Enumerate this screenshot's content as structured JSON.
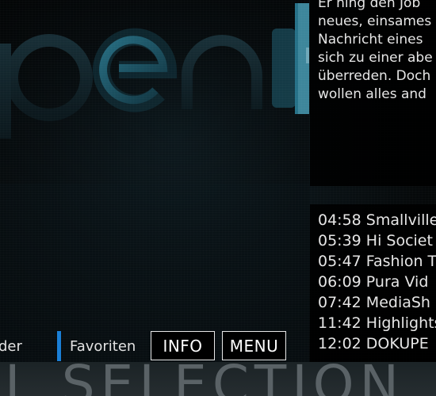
{
  "description": {
    "lines": [
      "Er hing den Job",
      "neues, einsames",
      "Nachricht eines",
      "sich zu einer abe",
      "überreden. Doch",
      "wollen alles and"
    ]
  },
  "schedule": {
    "items": [
      "04:58 Smallville",
      "05:39 Hi Societ",
      "05:47 Fashion T",
      "06:09 Pura Vid",
      "07:42 MediaSh",
      "11:42 Highlights",
      "12:02 DOKUPE"
    ]
  },
  "nav": {
    "partial_label": "der",
    "favorites_label": "Favoriten",
    "info_label": "INFO",
    "menu_label": "MENU"
  },
  "banner": {
    "text": "L SELECTION"
  },
  "colors": {
    "accent": "#1a7fd6",
    "logo_teal": "#1f5f6e",
    "text": "#e6e6e6"
  }
}
